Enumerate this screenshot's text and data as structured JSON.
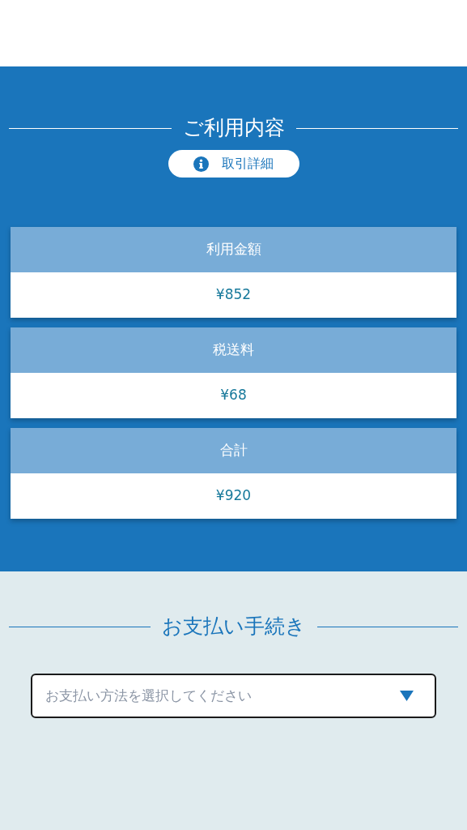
{
  "usage_section": {
    "title": "ご利用内容",
    "details_button": {
      "label": "取引詳細"
    },
    "items": [
      {
        "label": "利用金額",
        "amount": "¥852"
      },
      {
        "label": "税送料",
        "amount": "¥68"
      },
      {
        "label": "合計",
        "amount": "¥920"
      }
    ]
  },
  "payment_section": {
    "title": "お支払い手続き",
    "method_select": {
      "placeholder": "お支払い方法を選択してください"
    }
  }
}
